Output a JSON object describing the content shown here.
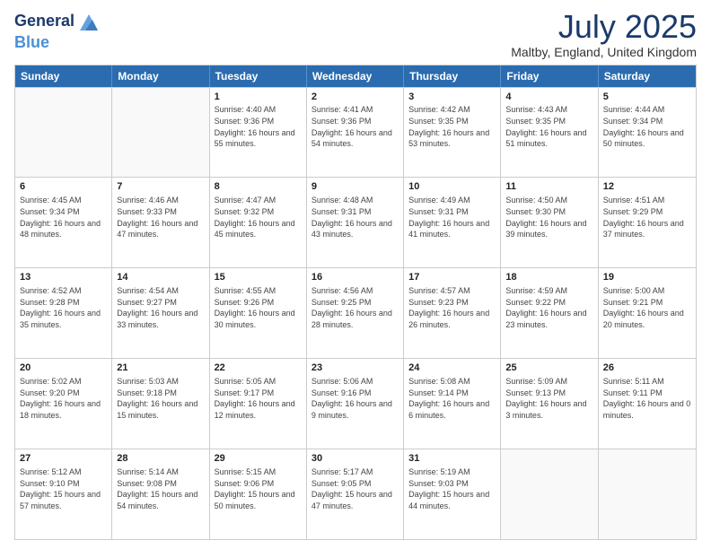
{
  "logo": {
    "line1": "General",
    "line2": "Blue"
  },
  "title": "July 2025",
  "subtitle": "Maltby, England, United Kingdom",
  "headers": [
    "Sunday",
    "Monday",
    "Tuesday",
    "Wednesday",
    "Thursday",
    "Friday",
    "Saturday"
  ],
  "rows": [
    [
      {
        "day": "",
        "info": ""
      },
      {
        "day": "",
        "info": ""
      },
      {
        "day": "1",
        "info": "Sunrise: 4:40 AM\nSunset: 9:36 PM\nDaylight: 16 hours and 55 minutes."
      },
      {
        "day": "2",
        "info": "Sunrise: 4:41 AM\nSunset: 9:36 PM\nDaylight: 16 hours and 54 minutes."
      },
      {
        "day": "3",
        "info": "Sunrise: 4:42 AM\nSunset: 9:35 PM\nDaylight: 16 hours and 53 minutes."
      },
      {
        "day": "4",
        "info": "Sunrise: 4:43 AM\nSunset: 9:35 PM\nDaylight: 16 hours and 51 minutes."
      },
      {
        "day": "5",
        "info": "Sunrise: 4:44 AM\nSunset: 9:34 PM\nDaylight: 16 hours and 50 minutes."
      }
    ],
    [
      {
        "day": "6",
        "info": "Sunrise: 4:45 AM\nSunset: 9:34 PM\nDaylight: 16 hours and 48 minutes."
      },
      {
        "day": "7",
        "info": "Sunrise: 4:46 AM\nSunset: 9:33 PM\nDaylight: 16 hours and 47 minutes."
      },
      {
        "day": "8",
        "info": "Sunrise: 4:47 AM\nSunset: 9:32 PM\nDaylight: 16 hours and 45 minutes."
      },
      {
        "day": "9",
        "info": "Sunrise: 4:48 AM\nSunset: 9:31 PM\nDaylight: 16 hours and 43 minutes."
      },
      {
        "day": "10",
        "info": "Sunrise: 4:49 AM\nSunset: 9:31 PM\nDaylight: 16 hours and 41 minutes."
      },
      {
        "day": "11",
        "info": "Sunrise: 4:50 AM\nSunset: 9:30 PM\nDaylight: 16 hours and 39 minutes."
      },
      {
        "day": "12",
        "info": "Sunrise: 4:51 AM\nSunset: 9:29 PM\nDaylight: 16 hours and 37 minutes."
      }
    ],
    [
      {
        "day": "13",
        "info": "Sunrise: 4:52 AM\nSunset: 9:28 PM\nDaylight: 16 hours and 35 minutes."
      },
      {
        "day": "14",
        "info": "Sunrise: 4:54 AM\nSunset: 9:27 PM\nDaylight: 16 hours and 33 minutes."
      },
      {
        "day": "15",
        "info": "Sunrise: 4:55 AM\nSunset: 9:26 PM\nDaylight: 16 hours and 30 minutes."
      },
      {
        "day": "16",
        "info": "Sunrise: 4:56 AM\nSunset: 9:25 PM\nDaylight: 16 hours and 28 minutes."
      },
      {
        "day": "17",
        "info": "Sunrise: 4:57 AM\nSunset: 9:23 PM\nDaylight: 16 hours and 26 minutes."
      },
      {
        "day": "18",
        "info": "Sunrise: 4:59 AM\nSunset: 9:22 PM\nDaylight: 16 hours and 23 minutes."
      },
      {
        "day": "19",
        "info": "Sunrise: 5:00 AM\nSunset: 9:21 PM\nDaylight: 16 hours and 20 minutes."
      }
    ],
    [
      {
        "day": "20",
        "info": "Sunrise: 5:02 AM\nSunset: 9:20 PM\nDaylight: 16 hours and 18 minutes."
      },
      {
        "day": "21",
        "info": "Sunrise: 5:03 AM\nSunset: 9:18 PM\nDaylight: 16 hours and 15 minutes."
      },
      {
        "day": "22",
        "info": "Sunrise: 5:05 AM\nSunset: 9:17 PM\nDaylight: 16 hours and 12 minutes."
      },
      {
        "day": "23",
        "info": "Sunrise: 5:06 AM\nSunset: 9:16 PM\nDaylight: 16 hours and 9 minutes."
      },
      {
        "day": "24",
        "info": "Sunrise: 5:08 AM\nSunset: 9:14 PM\nDaylight: 16 hours and 6 minutes."
      },
      {
        "day": "25",
        "info": "Sunrise: 5:09 AM\nSunset: 9:13 PM\nDaylight: 16 hours and 3 minutes."
      },
      {
        "day": "26",
        "info": "Sunrise: 5:11 AM\nSunset: 9:11 PM\nDaylight: 16 hours and 0 minutes."
      }
    ],
    [
      {
        "day": "27",
        "info": "Sunrise: 5:12 AM\nSunset: 9:10 PM\nDaylight: 15 hours and 57 minutes."
      },
      {
        "day": "28",
        "info": "Sunrise: 5:14 AM\nSunset: 9:08 PM\nDaylight: 15 hours and 54 minutes."
      },
      {
        "day": "29",
        "info": "Sunrise: 5:15 AM\nSunset: 9:06 PM\nDaylight: 15 hours and 50 minutes."
      },
      {
        "day": "30",
        "info": "Sunrise: 5:17 AM\nSunset: 9:05 PM\nDaylight: 15 hours and 47 minutes."
      },
      {
        "day": "31",
        "info": "Sunrise: 5:19 AM\nSunset: 9:03 PM\nDaylight: 15 hours and 44 minutes."
      },
      {
        "day": "",
        "info": ""
      },
      {
        "day": "",
        "info": ""
      }
    ]
  ]
}
